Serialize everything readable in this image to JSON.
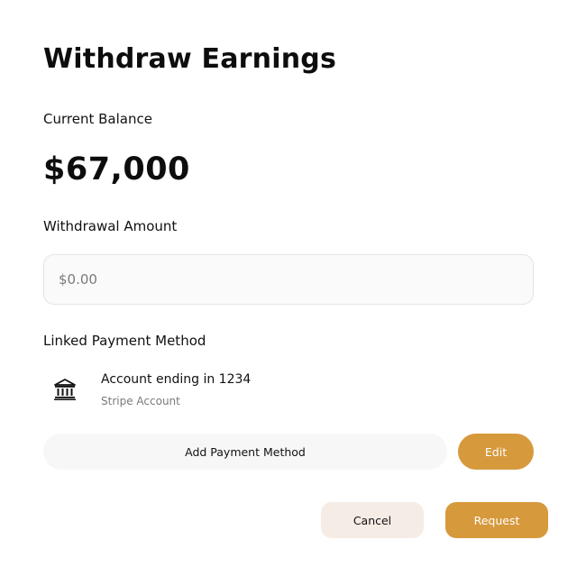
{
  "dialog": {
    "title": "Withdraw Earnings"
  },
  "balance": {
    "label": "Current Balance",
    "value": "$67,000"
  },
  "withdrawal": {
    "label": "Withdrawal Amount",
    "placeholder": "$0.00",
    "value": ""
  },
  "payment_method": {
    "label": "Linked Payment Method",
    "icon": "bank-icon",
    "account_line": "Account ending in  1234",
    "account_sub": "Stripe Account",
    "add_label": "Add Payment Method",
    "edit_label": "Edit"
  },
  "actions": {
    "cancel_label": "Cancel",
    "request_label": "Request"
  },
  "colors": {
    "accent": "#d6993c",
    "cancel_bg": "#f5ece6",
    "field_bg": "#fafafa",
    "muted_text": "#7a7a7a"
  }
}
